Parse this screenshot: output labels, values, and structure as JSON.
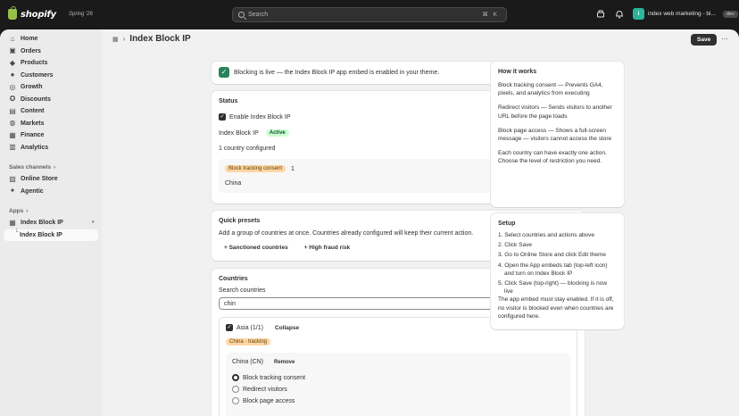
{
  "topbar": {
    "brand": "shopify",
    "edition": "Spring '26",
    "search_placeholder": "Search",
    "search_shortcut": "⌘ K",
    "store_initial": "i",
    "store_name": "index web marketing - bi...",
    "env_badge": "dev"
  },
  "sidebar": {
    "items": [
      {
        "label": "Home",
        "icon": "home-icon"
      },
      {
        "label": "Orders",
        "icon": "orders-icon"
      },
      {
        "label": "Products",
        "icon": "products-icon"
      },
      {
        "label": "Customers",
        "icon": "customers-icon"
      },
      {
        "label": "Growth",
        "icon": "growth-icon"
      },
      {
        "label": "Discounts",
        "icon": "discounts-icon"
      },
      {
        "label": "Content",
        "icon": "content-icon"
      },
      {
        "label": "Markets",
        "icon": "markets-icon"
      },
      {
        "label": "Finance",
        "icon": "finance-icon"
      },
      {
        "label": "Analytics",
        "icon": "analytics-icon"
      }
    ],
    "sales_channels_label": "Sales channels",
    "channels": [
      {
        "label": "Online Store"
      },
      {
        "label": "Agentic"
      }
    ],
    "apps_label": "Apps",
    "apps": [
      {
        "label": "Index Block IP"
      },
      {
        "label": "Index Block IP"
      }
    ]
  },
  "page": {
    "title": "Index Block IP",
    "save_label": "Save"
  },
  "banner": {
    "text": "Blocking is live — the Index Block IP app embed is enabled in your theme."
  },
  "status": {
    "title": "Status",
    "enable_label": "Enable Index Block IP",
    "app_name": "Index Block IP",
    "state_badge": "Active",
    "configured": "1 country configured",
    "action_badge": "Block tracking consent",
    "action_count": "1",
    "country": "China"
  },
  "presets": {
    "title": "Quick presets",
    "description": "Add a group of countries at once. Countries already configured will keep their current action.",
    "buttons": [
      "+ Sanctioned countries",
      "+ High fraud risk"
    ]
  },
  "countries": {
    "title": "Countries",
    "search_label": "Search countries",
    "search_value": "chin",
    "region": "Asia (1/1)",
    "collapse_label": "Collapse",
    "region_badge": "China · tracking",
    "country_name": "China (CN)",
    "remove_label": "Remove",
    "options": [
      "Block tracking consent",
      "Redirect visitors",
      "Block page access"
    ],
    "selected_index": 0
  },
  "how_it_works": {
    "title": "How it works",
    "paragraphs": [
      "Block tracking consent — Prevents GA4, pixels, and analytics from executing",
      "Redirect visitors — Sends visitors to another URL before the page loads",
      "Block page access — Shows a full-screen message — visitors cannot access the store",
      "Each country can have exactly one action. Choose the level of restriction you need."
    ]
  },
  "setup": {
    "title": "Setup",
    "steps": [
      "1. Select countries and actions above",
      "2. Click Save",
      "3. Go to Online Store and click Edit theme",
      "4. Open the App embeds tab (top-left icon) and turn on Index Block IP",
      "5. Click Save (top-right) — blocking is now live"
    ],
    "note": "The app embed must stay enabled. If it is off, no visitor is blocked even when countries are configured here."
  }
}
